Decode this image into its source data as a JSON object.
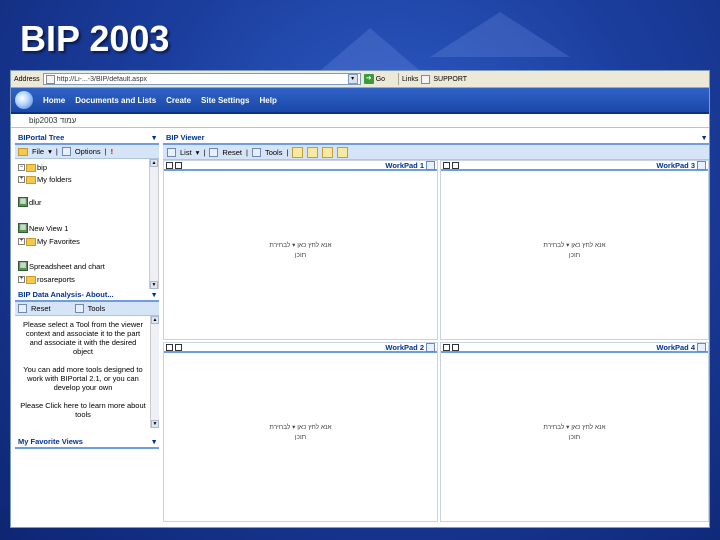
{
  "slide": {
    "title": "BIP 2003"
  },
  "browser": {
    "address_label": "Address",
    "url": "http://Li-...-3/BIP/default.aspx",
    "go_label": "Go",
    "links_label": "Links",
    "links_value": "SUPPORT"
  },
  "topnav": {
    "items": [
      "Home",
      "Documents and Lists",
      "Create",
      "Site Settings",
      "Help"
    ]
  },
  "site_title": "bip2003 עמוד",
  "portal_tree": {
    "header": "BIPortal Tree",
    "toolbar": {
      "file": "File",
      "options": "Options"
    },
    "items": [
      "bip",
      "My folders",
      "dlur",
      "New View 1",
      "My Favorites",
      "Spreadsheet and chart",
      "rosareports"
    ]
  },
  "data_analysis": {
    "header": "BIP Data Analysis- About...",
    "toolbar": {
      "reset": "Reset",
      "tools": "Tools"
    },
    "para1": "Please select a Tool from the viewer context and associate it to the part and associate it with the desired object",
    "para2": "You can add more tools designed to work with BIPortal 2.1, or you can develop your own",
    "para3": "Please Click here to learn more about tools"
  },
  "favorite_views": {
    "header": "My Favorite Views"
  },
  "viewer": {
    "header": "BIP Viewer",
    "toolbar": {
      "list": "List",
      "reset": "Reset",
      "tools": "Tools"
    },
    "workpads": [
      {
        "title": "WorkPad 1",
        "line1": "אנא לחץ כאן ▾ לבחירת",
        "line2": "תוכן"
      },
      {
        "title": "WorkPad 3",
        "line1": "אנא לחץ כאן ▾ לבחירת",
        "line2": "תוכן"
      },
      {
        "title": "WorkPad 2",
        "line1": "אנא לחץ כאן ▾ לבחירת",
        "line2": "תוכן"
      },
      {
        "title": "WorkPad 4",
        "line1": "אנא לחץ כאן ▾ לבחירת",
        "line2": "תוכן"
      }
    ]
  },
  "icons": {
    "header_dropdown": "chevron-down-icon",
    "folder": "folder-icon",
    "view": "view-icon"
  }
}
